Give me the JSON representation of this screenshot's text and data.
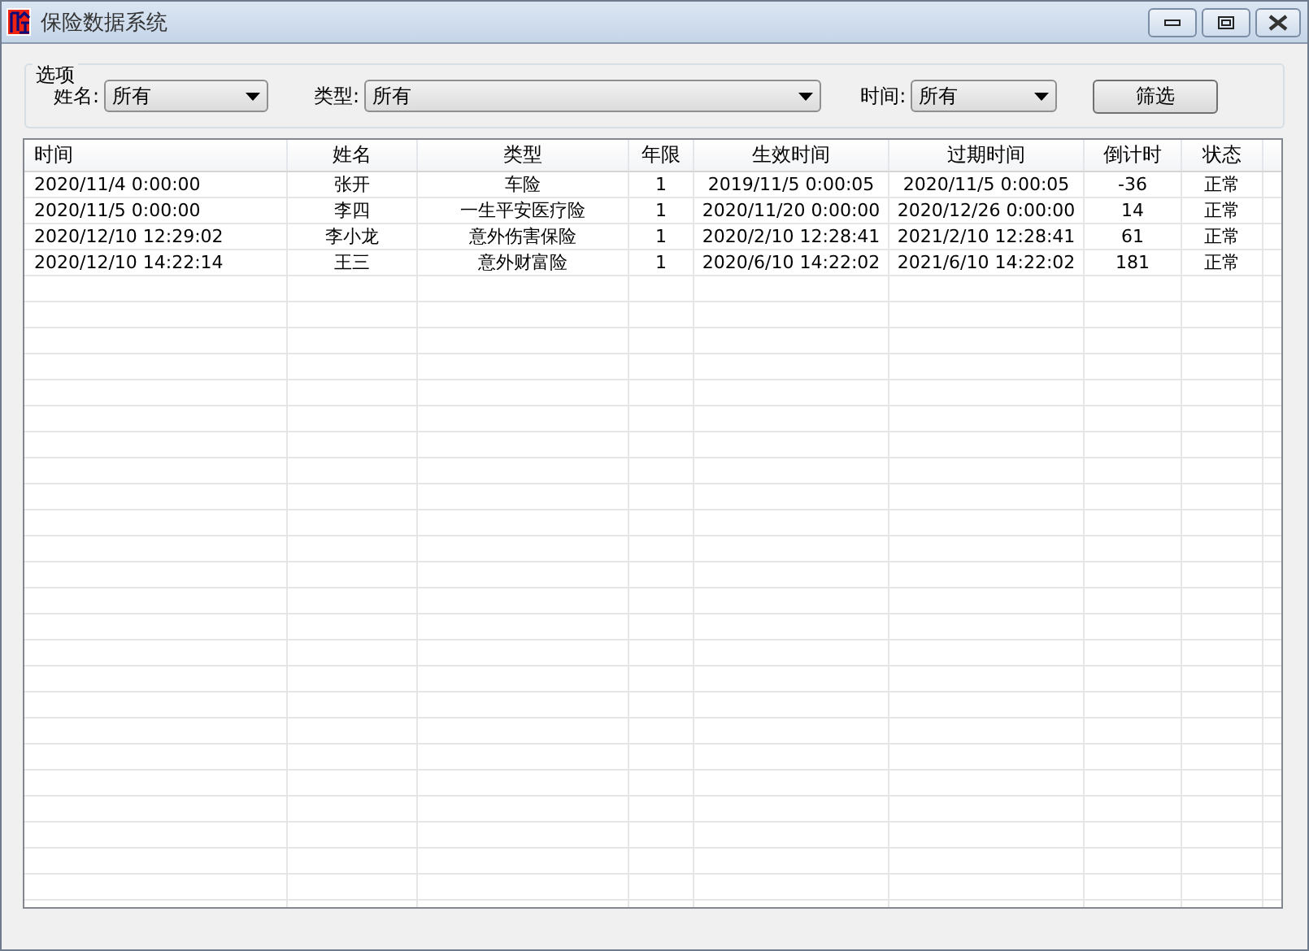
{
  "window": {
    "title": "保险数据系统"
  },
  "options": {
    "label": "选项",
    "filters": [
      {
        "label": "姓名:",
        "value": "所有"
      },
      {
        "label": "类型:",
        "value": "所有"
      },
      {
        "label": "时间:",
        "value": "所有"
      }
    ],
    "button": "筛选"
  },
  "table": {
    "columns": [
      "时间",
      "姓名",
      "类型",
      "年限",
      "生效时间",
      "过期时间",
      "倒计时",
      "状态"
    ],
    "rows": [
      [
        "2020/11/4 0:00:00",
        "张开",
        "车险",
        "1",
        "2019/11/5 0:00:05",
        "2020/11/5 0:00:05",
        "-36",
        "正常"
      ],
      [
        "2020/11/5 0:00:00",
        "李四",
        "一生平安医疗险",
        "1",
        "2020/11/20 0:00:00",
        "2020/12/26 0:00:00",
        "14",
        "正常"
      ],
      [
        "2020/12/10 12:29:02",
        "李小龙",
        "意外伤害保险",
        "1",
        "2020/2/10 12:28:41",
        "2021/2/10 12:28:41",
        "61",
        "正常"
      ],
      [
        "2020/12/10 14:22:14",
        "王三",
        "意外财富险",
        "1",
        "2020/6/10 14:22:02",
        "2021/6/10 14:22:02",
        "181",
        "正常"
      ]
    ]
  }
}
